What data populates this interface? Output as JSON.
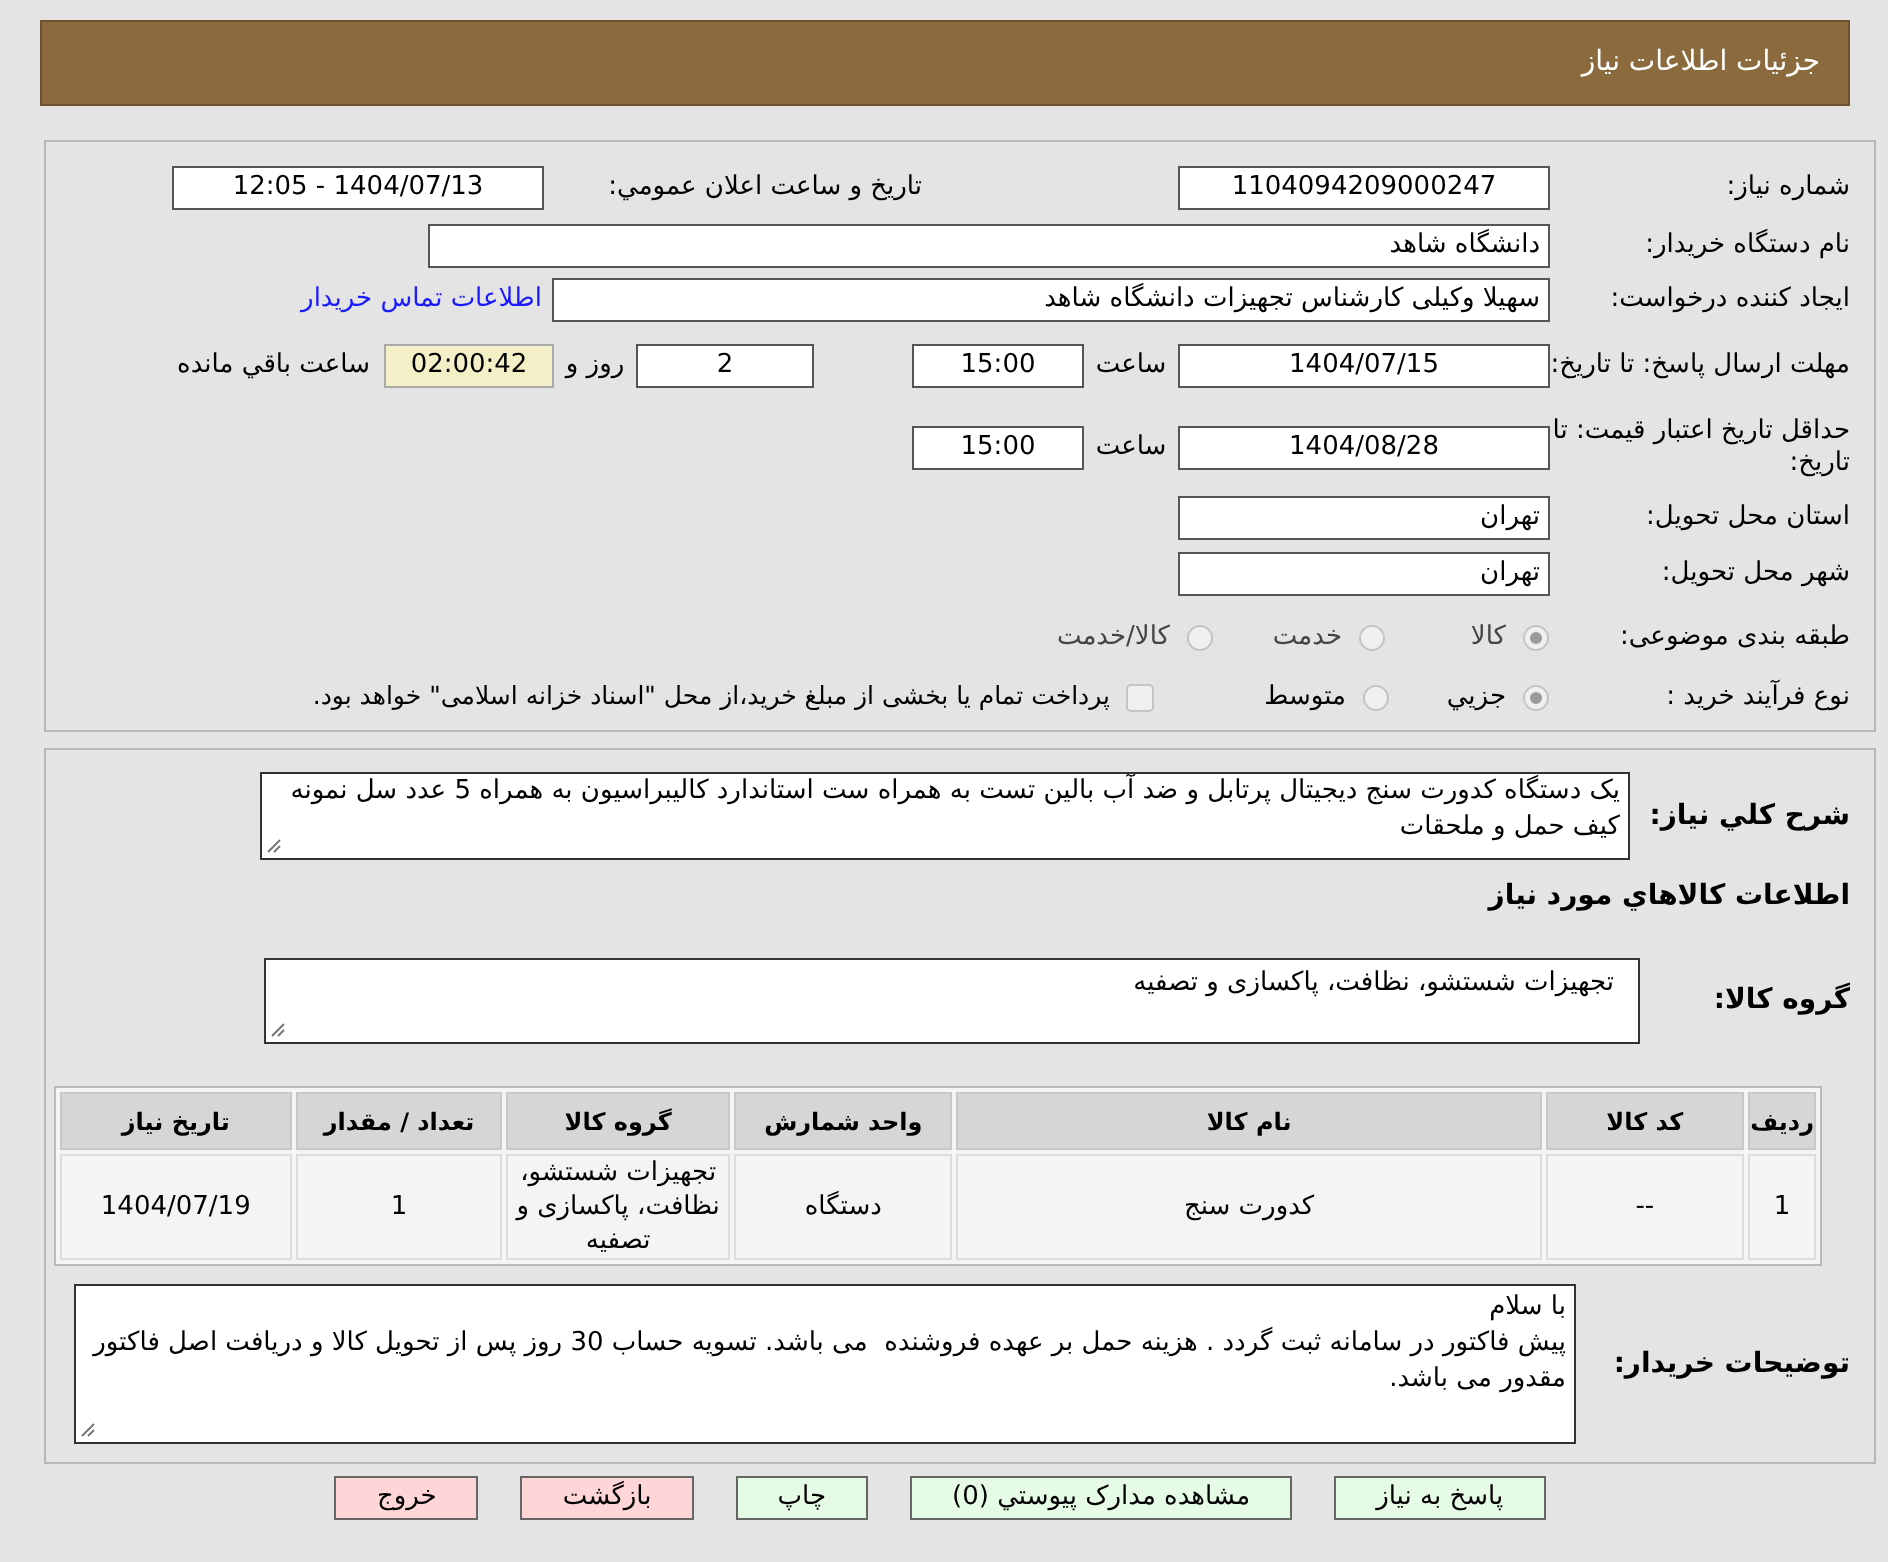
{
  "header": {
    "title": "جزئیات اطلاعات نیاز"
  },
  "need_number": {
    "label": "شماره نیاز:",
    "value": "1104094209000247"
  },
  "announce": {
    "label": "تاریخ و ساعت اعلان عمومي:",
    "value": "1404/07/13 - 12:05"
  },
  "buyer": {
    "label": "نام دستگاه خریدار:",
    "value": "دانشگاه شاهد"
  },
  "requester": {
    "label": "ایجاد کننده درخواست:",
    "value": "سهیلا وکیلی کارشناس تجهیزات دانشگاه شاهد",
    "link": "اطلاعات تماس خريدار"
  },
  "deadline": {
    "label": "مهلت ارسال پاسخ: تا تاریخ:",
    "date": "1404/07/15",
    "time_label": "ساعت",
    "time": "15:00",
    "days": "2",
    "days_label": "روز و",
    "remaining": "02:00:42",
    "remaining_label": "ساعت باقي مانده"
  },
  "validity": {
    "label": "حداقل تاریخ اعتبار قیمت: تا تاریخ:",
    "date": "1404/08/28",
    "time_label": "ساعت",
    "time": "15:00"
  },
  "province": {
    "label": "استان محل تحویل:",
    "value": "تهران"
  },
  "city": {
    "label": "شهر محل تحویل:",
    "value": "تهران"
  },
  "category": {
    "label": "طبقه بندی موضوعی:",
    "options": [
      {
        "label": "کالا",
        "selected": true
      },
      {
        "label": "خدمت",
        "selected": false
      },
      {
        "label": "کالا/خدمت",
        "selected": false
      }
    ]
  },
  "process": {
    "label": "نوع فرآیند خرید :",
    "options": [
      {
        "label": "جزيي",
        "selected": true
      },
      {
        "label": "متوسط",
        "selected": false
      }
    ],
    "checkbox": {
      "label": "پرداخت تمام یا بخشی از مبلغ خرید،از محل \"اسناد خزانه اسلامی\" خواهد بود.",
      "checked": false
    }
  },
  "description": {
    "label": "شرح کلي نیاز:",
    "value": "یک دستگاه کدورت سنج دیجیتال پرتابل و ضد آب بالین تست به همراه ست استاندارد کالیبراسیون به همراه 5 عدد سل نمونه کیف حمل و ملحقات"
  },
  "items_title": "اطلاعات کالاهاي مورد نیاز",
  "group": {
    "label": "گروه کالا:",
    "value": "تجهیزات شستشو، نظافت، پاکسازی و تصفیه"
  },
  "table": {
    "columns": [
      "ردیف",
      "کد کالا",
      "نام کالا",
      "واحد شمارش",
      "گروه کالا",
      "تعداد / مقدار",
      "تاریخ نیاز"
    ],
    "rows": [
      [
        "1",
        "--",
        "کدورت سنج",
        "دستگاه",
        "تجهیزات شستشو، نظافت، پاکسازی و تصفیه",
        "1",
        "1404/07/19"
      ]
    ]
  },
  "buyer_notes": {
    "label": "توضیحات خریدار:",
    "value": "با سلام\nپیش فاکتور در سامانه ثبت گردد . هزینه حمل بر عهده فروشنده  می باشد. تسویه حساب 30 روز پس از تحویل کالا و دریافت اصل فاکتور مقدور می باشد."
  },
  "buttons": [
    {
      "label": "پاسخ به نیاز",
      "kind": "normal"
    },
    {
      "label": "مشاهده مدارک پیوستي (0)",
      "kind": "normal"
    },
    {
      "label": "چاپ",
      "kind": "normal"
    },
    {
      "label": "بازگشت",
      "kind": "danger"
    },
    {
      "label": "خروج",
      "kind": "danger"
    }
  ]
}
